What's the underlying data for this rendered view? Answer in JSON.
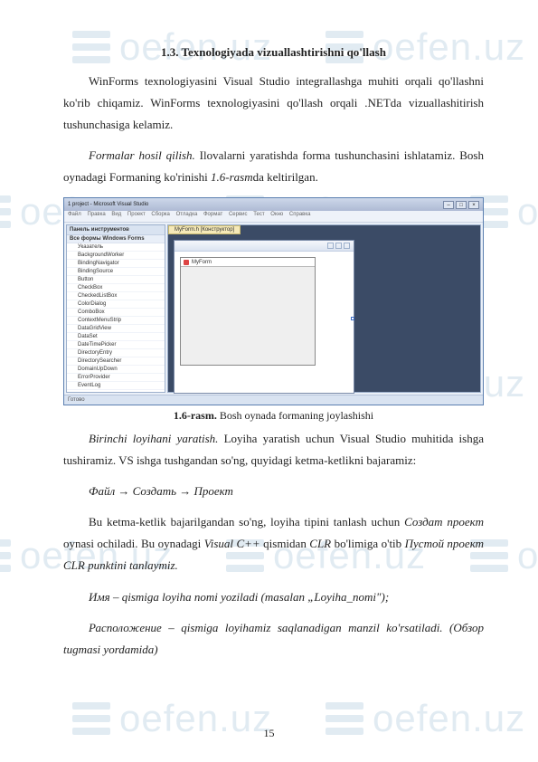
{
  "watermark": "oefen.uz",
  "section_title": "1.3. Texnologiyada vizuallashtirishni qo'llash",
  "para1": "WinForms texnologiyasini Visual Studio integrallashga muhiti orqali qo'llashni ko'rib chiqamiz. WinForms texnologiyasini qo'llash orqali .NETda vizuallashitirish tushunchasiga kelamiz.",
  "para2_lead": "Formalar hosil qilish.",
  "para2_rest": " Ilovalarni yaratishda forma tushunchasini ishlatamiz. Bosh oynadagi Formaning ko'rinishi ",
  "para2_ref": "1.6-rasm",
  "para2_tail": "da keltirilgan.",
  "vs": {
    "title": "1 project - Microsoft Visual Studio",
    "menu": [
      "Файл",
      "Правка",
      "Вид",
      "Проект",
      "Сборка",
      "Отладка",
      "Формат",
      "Сервис",
      "Тест",
      "Окно",
      "Справка"
    ],
    "tab": "MyForm.h [Конструктор]",
    "toolbox_title": "Панель инструментов",
    "group": "Все формы Windows Forms",
    "items": [
      "Указатель",
      "BackgroundWorker",
      "BindingNavigator",
      "BindingSource",
      "Button",
      "CheckBox",
      "CheckedListBox",
      "ColorDialog",
      "ComboBox",
      "ContextMenuStrip",
      "DataGridView",
      "DataSet",
      "DateTimePicker",
      "DirectoryEntry",
      "DirectorySearcher",
      "DomainUpDown",
      "ErrorProvider",
      "EventLog"
    ],
    "form_title": "MyForm",
    "status": "Готово"
  },
  "fig_label": "1.6-rasm.",
  "fig_caption": " Bosh oynada formaning joylashishi",
  "para3_lead": "Birinchi loyihani yaratish.",
  "para3_rest": " Loyiha yaratish uchun Visual Studio muhitida ishga tushiramiz. VS ishga tushgandan so'ng, quyidagi ketma-ketlikni bajaramiz:",
  "menu_path": "Файл → Создать → Проект",
  "para4_a": "Bu ketma-ketlik bajarilgandan so'ng, loyiha tipini tanlash uchun ",
  "para4_b": "Создат проект",
  "para4_c": " oynasi ochiladi. Bu oynadagi ",
  "para4_d": "Visual C++",
  "para4_e": " qismidan ",
  "para4_f": "CLR",
  "para4_g": " bo'limiga o'tib ",
  "para4_h": "Пустой проект CLR punktini tanlaymiz.",
  "para5": "Имя – qismiga loyiha nomi yoziladi (masalan „Loyiha_nomi\");",
  "para6": "Расположение – qismiga loyihamiz saqlanadigan manzil ko'rsatiladi. (Обзор tugmasi yordamida)",
  "page_number": "15"
}
